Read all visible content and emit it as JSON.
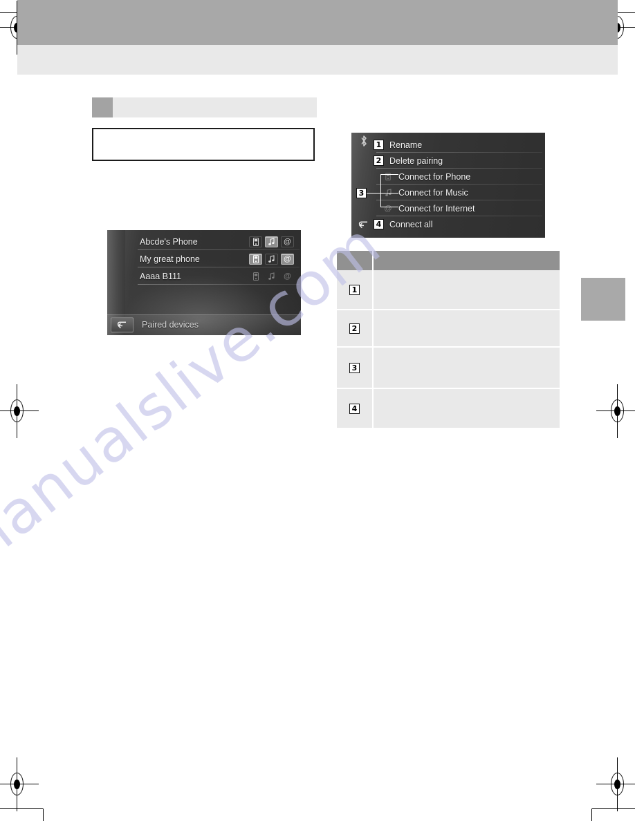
{
  "page": {
    "header_band_color": "#a8a8a8",
    "sub_band_color": "#e9e9e9",
    "edge_tab_color": "#a9a9a9",
    "watermark_text": "manualslive.com"
  },
  "section": {
    "heading_title": "",
    "note_box_text": ""
  },
  "device_screen": {
    "figure_id": "EN6040DC",
    "bottom_label": "Paired devices",
    "back_icon": "back-arrow-icon",
    "rows": [
      {
        "name": "Abcde's Phone",
        "icons": [
          {
            "name": "phone-icon",
            "state": "norm"
          },
          {
            "name": "music-note-icon",
            "state": "on"
          },
          {
            "name": "at-sign-internet-icon",
            "state": "norm"
          }
        ]
      },
      {
        "name": "My great phone",
        "icons": [
          {
            "name": "phone-icon",
            "state": "on"
          },
          {
            "name": "music-note-icon",
            "state": "norm"
          },
          {
            "name": "at-sign-internet-icon",
            "state": "on"
          }
        ]
      },
      {
        "name": "Aaaa B111",
        "icons": [
          {
            "name": "phone-icon",
            "state": "dim"
          },
          {
            "name": "music-note-icon",
            "state": "dim"
          },
          {
            "name": "at-sign-internet-icon",
            "state": "dim"
          }
        ]
      }
    ]
  },
  "menu_screen": {
    "figure_id": "EN6059DC",
    "bluetooth_icon": "bluetooth-icon",
    "back_icon": "back-arrow-icon",
    "items": [
      {
        "callout": "1",
        "label": "Rename",
        "icon": null
      },
      {
        "callout": "2",
        "label": "Delete pairing",
        "icon": null
      },
      {
        "callout": null,
        "label": "Connect for Phone",
        "icon": "phone-icon"
      },
      {
        "callout": null,
        "label": "Connect for Music",
        "icon": "music-note-icon"
      },
      {
        "callout": null,
        "label": "Connect for Internet",
        "icon": "at-sign-internet-icon"
      },
      {
        "callout": "4",
        "label": "Connect all",
        "icon": null
      }
    ],
    "group_callout": "3"
  },
  "legend_table": {
    "headers": [
      "",
      ""
    ],
    "rows": [
      {
        "number": "1",
        "description": ""
      },
      {
        "number": "2",
        "description": ""
      },
      {
        "number": "3",
        "description": ""
      },
      {
        "number": "4",
        "description": ""
      }
    ]
  }
}
